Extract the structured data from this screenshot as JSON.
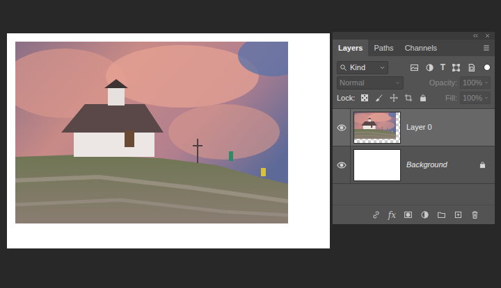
{
  "tabs": [
    {
      "label": "Layers",
      "selected": true
    },
    {
      "label": "Paths",
      "selected": false
    },
    {
      "label": "Channels",
      "selected": false
    }
  ],
  "filter": {
    "value": "Kind",
    "enabled": true,
    "text_icon": "T"
  },
  "blend_mode": {
    "value": "Normal",
    "disabled": true
  },
  "opacity": {
    "label": "Opacity:",
    "value": "100%",
    "disabled": true
  },
  "lock": {
    "label": "Lock:"
  },
  "fill": {
    "label": "Fill:",
    "value": "100%",
    "disabled": true
  },
  "layers": [
    {
      "name": "Layer 0",
      "kind": "photo",
      "visible": true,
      "selected": true,
      "locked": false
    },
    {
      "name": "Background",
      "kind": "background",
      "visible": true,
      "selected": false,
      "locked": true
    }
  ],
  "footer": {
    "fx": "fx"
  }
}
